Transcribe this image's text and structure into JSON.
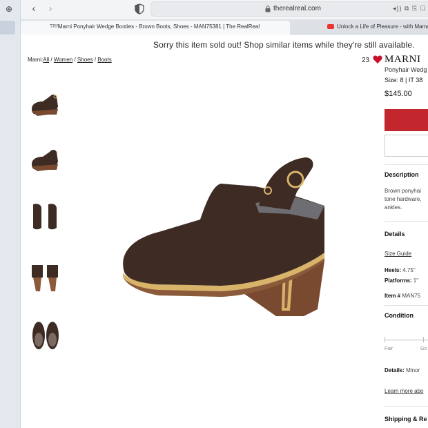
{
  "browser": {
    "url": "therealreal.com",
    "toolbar_icons": "◂)) ⧉ ⎘ ☐",
    "tabs": [
      {
        "label": "Marni Ponyhair Wedge Booties - Brown Boots, Shoes - MAN75381 | The RealReal",
        "active": true
      },
      {
        "label": "Unlock a Life of Pleasure - with Mama",
        "active": false
      }
    ]
  },
  "banner": {
    "sold_out": "Sorry this item sold out! Shop similar items while they're still available."
  },
  "breadcrumb": {
    "brand": "Marni",
    "items": [
      "All",
      "Women",
      "Shoes",
      "Boots"
    ]
  },
  "product": {
    "favorites_count": "23",
    "brand": "MARNI",
    "name": "Ponyhair Wedg",
    "size": "Size: 8 | IT 38",
    "price": "$145.00"
  },
  "description": {
    "title": "Description",
    "lines": [
      "Brown ponyhai",
      "tone hardware,",
      "ankles."
    ]
  },
  "details": {
    "title": "Details",
    "size_guide": "Size Guide",
    "heels_label": "Heels:",
    "heels_value": "4.75\"",
    "platforms_label": "Platforms:",
    "platforms_value": "1\"",
    "item_label": "Item #",
    "item_value": "MAN75"
  },
  "condition": {
    "title": "Condition",
    "scale": [
      "Fair",
      "Go"
    ],
    "details_label": "Details:",
    "details_value": "Minor",
    "learn_more": "Learn more abo"
  },
  "shipping": {
    "title": "Shipping & Re"
  },
  "colors": {
    "accent_red": "#c1272d",
    "heart_red": "#c8102e",
    "shoe_brown": "#3d2b24"
  }
}
